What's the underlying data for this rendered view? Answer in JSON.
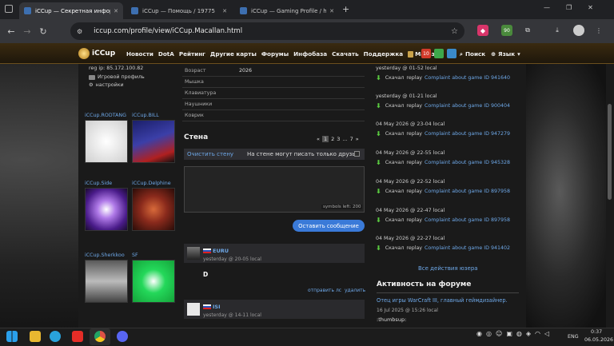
{
  "browser": {
    "tabs": [
      {
        "title": "iCCup — Секретная инфор"
      },
      {
        "title": "iCCup — Помощь / 19775"
      },
      {
        "title": "iCCup — Gaming Profile / h"
      }
    ],
    "url": "iccup.com/profile/view/iCCup.Macallan.html",
    "badge_text": "90"
  },
  "site": {
    "logo": "iCCup",
    "menu": [
      "Новости",
      "DotA",
      "Рейтинг",
      "Другие карты",
      "Форумы",
      "Инфобаза",
      "Скачать",
      "Поддержка",
      "Магазин"
    ],
    "notif_count": "10",
    "search_label": "Поиск",
    "lang_label": "Язык"
  },
  "profile": {
    "reg_ip": "reg ip: 85.172.100.82",
    "game_profile_link": "Игровой профиль",
    "settings_link": "настройки",
    "details": [
      {
        "label": "Возраст",
        "value": "2026"
      },
      {
        "label": "Мышка",
        "value": ""
      },
      {
        "label": "Клавиатура",
        "value": ""
      },
      {
        "label": "Наушники",
        "value": ""
      },
      {
        "label": "Коврик",
        "value": ""
      }
    ]
  },
  "friends": [
    {
      "name": "iCCup.RODTANG",
      "color": "#e8e8e8"
    },
    {
      "name": "iCCup.BILL",
      "color": "#3b3fa8"
    },
    {
      "name": "iCCup.Side",
      "color": "#6a2fb8"
    },
    {
      "name": "iCCup.Delphine",
      "color": "#8a2a1c"
    },
    {
      "name": "iCCup.Sherkkoo",
      "color": "#9a9a9a"
    },
    {
      "name": "SF",
      "color": "#24d85a"
    }
  ],
  "wall": {
    "title": "Стена",
    "pagination": [
      "«",
      "1",
      "2",
      "3",
      "...",
      "7",
      "»"
    ],
    "clear_label": "Очистить стену",
    "friends_only_label": "На стене могут писать только друзья",
    "symbols_left": "symbols left: 200",
    "submit_label": "Оставить сообщение",
    "posts": [
      {
        "author": "EURU",
        "time": "yesterday @ 20-05 local",
        "text": "D",
        "reply": "отправить лс",
        "delete": "удалить"
      },
      {
        "author": "ISI",
        "time": "yesterday @ 14-11 local",
        "text": "",
        "reply": "",
        "delete": ""
      }
    ]
  },
  "activity": {
    "entries": [
      {
        "date": "yesterday @ 01-52 local",
        "action": "Скачал",
        "kind": "replay",
        "link": "Complaint about game ID 941640"
      },
      {
        "date": "yesterday @ 01-21 local",
        "action": "Скачал",
        "kind": "replay",
        "link": "Complaint about game ID 900404"
      },
      {
        "date": "04 May 2026 @ 23-04 local",
        "action": "Скачал",
        "kind": "replay",
        "link": "Complaint about game ID 947279"
      },
      {
        "date": "04 May 2026 @ 22-55 local",
        "action": "Скачал",
        "kind": "replay",
        "link": "Complaint about game ID 945328"
      },
      {
        "date": "04 May 2026 @ 22-52 local",
        "action": "Скачал",
        "kind": "replay",
        "link": "Complaint about game ID 897958"
      },
      {
        "date": "04 May 2026 @ 22-47 local",
        "action": "Скачал",
        "kind": "replay",
        "link": "Complaint about game ID 897958"
      },
      {
        "date": "04 May 2026 @ 22-27 local",
        "action": "Скачал",
        "kind": "replay",
        "link": "Complaint about game ID 941402"
      }
    ],
    "all_link": "Все действия юзера"
  },
  "forum": {
    "title": "Активность на форуме",
    "post_title": "Отец игры WarCraft III, главный геймдизайнер.",
    "post_date": "16 Jul 2025 @ 15:26 local",
    "post_text": ":thumbsup:"
  },
  "taskbar": {
    "lang": "ENG",
    "time": "0:37",
    "date": "06.05.2026"
  }
}
